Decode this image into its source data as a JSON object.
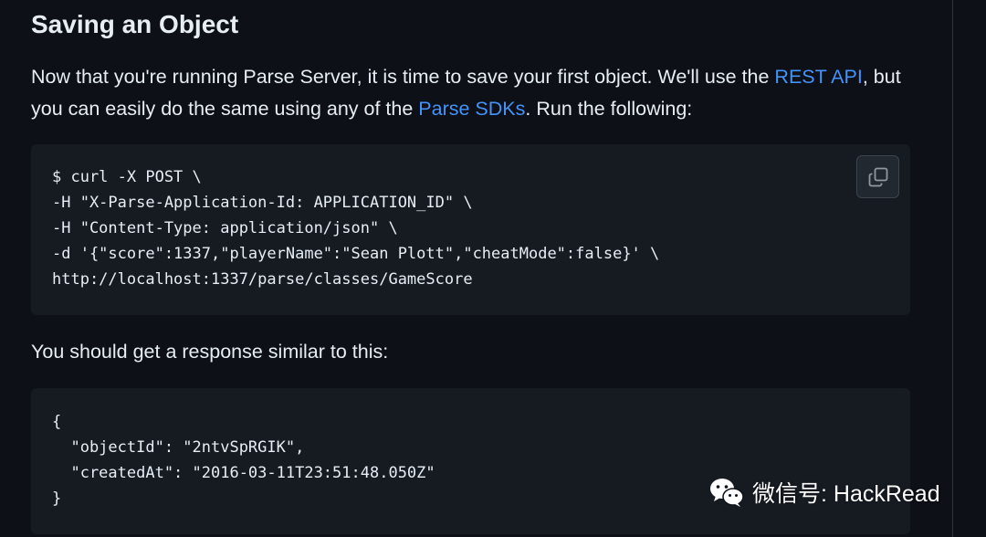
{
  "section": {
    "heading": "Saving an Object"
  },
  "intro": {
    "text_1": "Now that you're running Parse Server, it is time to save your first object. We'll use the ",
    "link_rest": "REST API",
    "text_2": ", but you can easily do the same using any of the ",
    "link_sdks": "Parse SDKs",
    "text_3": ". Run the following:"
  },
  "command_block": {
    "code": "$ curl -X POST \\\n-H \"X-Parse-Application-Id: APPLICATION_ID\" \\\n-H \"Content-Type: application/json\" \\\n-d '{\"score\":1337,\"playerName\":\"Sean Plott\",\"cheatMode\":false}' \\\nhttp://localhost:1337/parse/classes/GameScore",
    "copy_icon": "copy-icon"
  },
  "response_intro": {
    "text": "You should get a response similar to this:"
  },
  "response_block": {
    "code": "{\n  \"objectId\": \"2ntvSpRGIK\",\n  \"createdAt\": \"2016-03-11T23:51:48.050Z\"\n}"
  },
  "watermark": {
    "text": "微信号: HackRead",
    "icon": "wechat-icon"
  },
  "colors": {
    "background": "#0d1117",
    "code_background": "#161b22",
    "link": "#4493f8",
    "text": "#e6edf3"
  }
}
